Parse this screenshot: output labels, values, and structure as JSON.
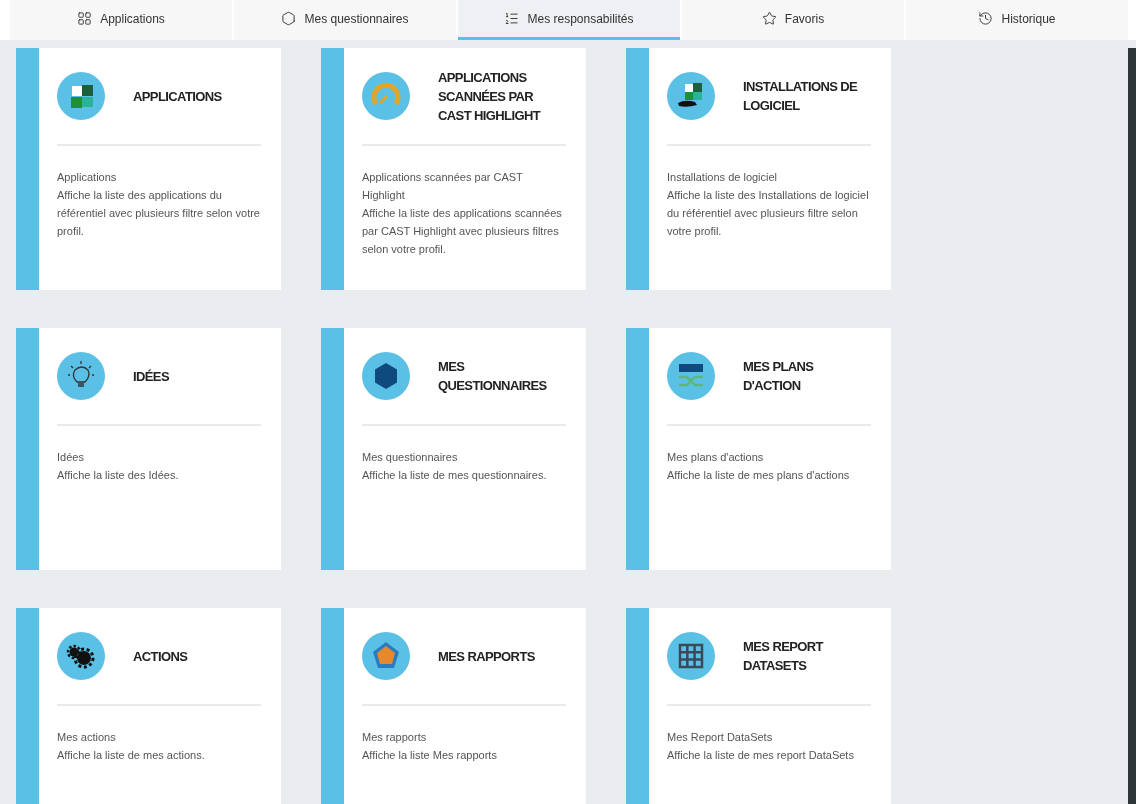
{
  "tabs": [
    {
      "label": "Applications",
      "kind": "apps",
      "selected": false
    },
    {
      "label": "Mes questionnaires",
      "kind": "hexagon",
      "selected": false
    },
    {
      "label": "Mes responsabilités",
      "kind": "list",
      "selected": true
    },
    {
      "label": "Favoris",
      "kind": "star",
      "selected": false
    },
    {
      "label": "Historique",
      "kind": "history",
      "selected": false
    }
  ],
  "cards": [
    {
      "title": "APPLICATIONS",
      "kind": "puzzle",
      "lines": [
        "Applications",
        "Affiche la liste des applications du référentiel avec plusieurs filtre selon votre profil."
      ]
    },
    {
      "title": "APPLICATIONS SCANNÉES PAR CAST HIGHLIGHT",
      "kind": "gauge",
      "lines": [
        "Applications scannées par CAST Highlight",
        "Affiche la liste des applications scannées par CAST Highlight avec plusieurs filtres selon votre profil."
      ]
    },
    {
      "title": "INSTALLATIONS DE LOGICIEL",
      "kind": "puzzlehand",
      "lines": [
        "Installations de logiciel",
        "Affiche la liste des Installations de logiciel du référentiel avec plusieurs filtre selon votre profil."
      ]
    },
    {
      "title": "IDÉES",
      "kind": "bulb",
      "lines": [
        "Idées",
        "Affiche la liste des Idées."
      ]
    },
    {
      "title": "MES QUESTIONNAIRES",
      "kind": "hexagon",
      "lines": [
        "Mes questionnaires",
        "Affiche la liste de mes questionnaires."
      ]
    },
    {
      "title": "MES PLANS D'ACTION",
      "kind": "plans",
      "lines": [
        "Mes plans d'actions",
        "Affiche la liste de mes plans d'actions"
      ]
    },
    {
      "title": "ACTIONS",
      "kind": "gears",
      "lines": [
        "Mes actions",
        "Affiche la liste de mes actions."
      ]
    },
    {
      "title": "MES RAPPORTS",
      "kind": "radar",
      "lines": [
        "Mes rapports",
        "Affiche la liste Mes rapports"
      ]
    },
    {
      "title": "MES REPORT DATASETS",
      "kind": "grid",
      "lines": [
        "Mes Report DataSets",
        "Affiche la liste de mes report DataSets"
      ]
    }
  ]
}
